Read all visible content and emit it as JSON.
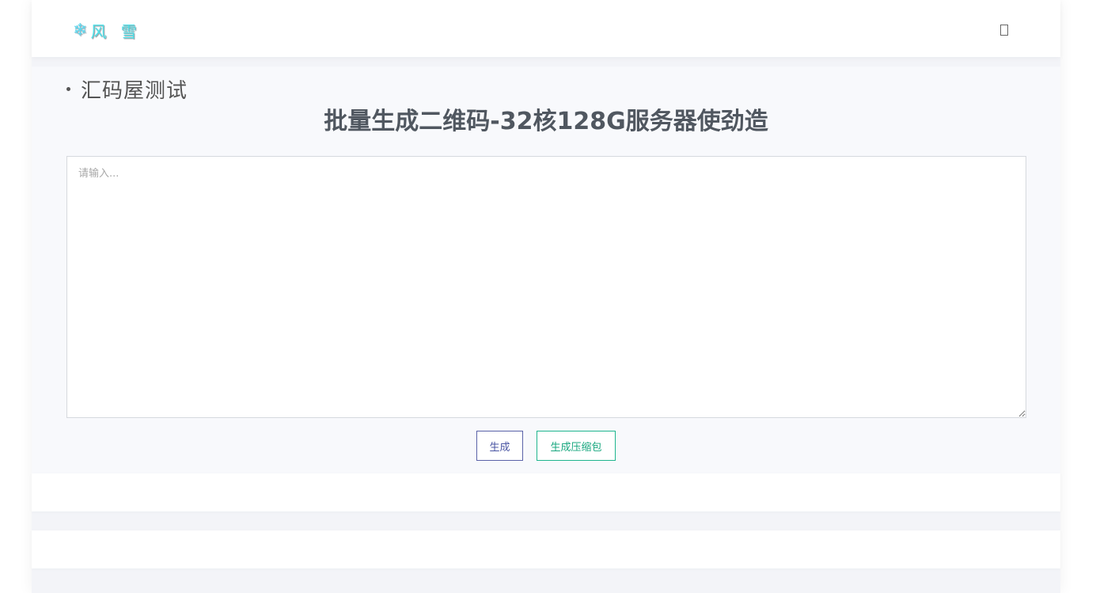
{
  "header": {
    "logo_text": "风 雪",
    "logo_icon": "snowflake-icon",
    "menu_icon": "menu-icon"
  },
  "section": {
    "title": "汇码屋测试",
    "heading": "批量生成二维码-32核128G服务器使劲造"
  },
  "input": {
    "placeholder": "请输入...",
    "value": ""
  },
  "actions": {
    "generate_label": "生成",
    "zip_label": "生成压缩包"
  },
  "colors": {
    "generate_border": "#5a62a8",
    "zip_border": "#1fb58e",
    "logo": "#4ee0e8"
  }
}
